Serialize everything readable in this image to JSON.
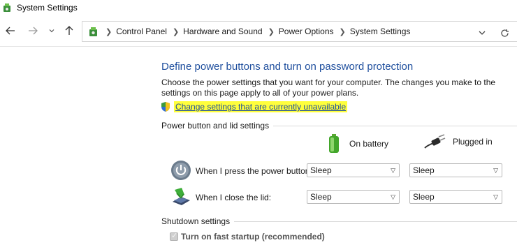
{
  "window": {
    "title": "System Settings"
  },
  "nav": {
    "back_icon": "arrow-left-icon",
    "forward_icon": "arrow-right-icon",
    "recent_icon": "chevron-down-icon",
    "up_icon": "arrow-up-icon"
  },
  "address": {
    "crumbs": [
      "Control Panel",
      "Hardware and Sound",
      "Power Options",
      "System Settings"
    ],
    "dropdown_icon": "chevron-down-icon",
    "refresh_icon": "refresh-icon"
  },
  "main": {
    "title": "Define power buttons and turn on password protection",
    "intro": "Choose the power settings that you want for your computer. The changes you make to the settings on this page apply to all of your power plans.",
    "change_link": "Change settings that are currently unavailable",
    "power_section": {
      "heading": "Power button and lid settings",
      "col_battery": "On battery",
      "col_plugged": "Plugged in",
      "rows": [
        {
          "label": "When I press the power button:",
          "battery": "Sleep",
          "plugged": "Sleep"
        },
        {
          "label": "When I close the lid:",
          "battery": "Sleep",
          "plugged": "Sleep"
        }
      ]
    },
    "shutdown_section": {
      "heading": "Shutdown settings",
      "fast_startup": "Turn on fast startup (recommended)",
      "fast_startup_checked": true
    }
  },
  "colors": {
    "link": "#1e4e9d",
    "highlight": "#ffff3c",
    "title": "#1e4e9d"
  }
}
